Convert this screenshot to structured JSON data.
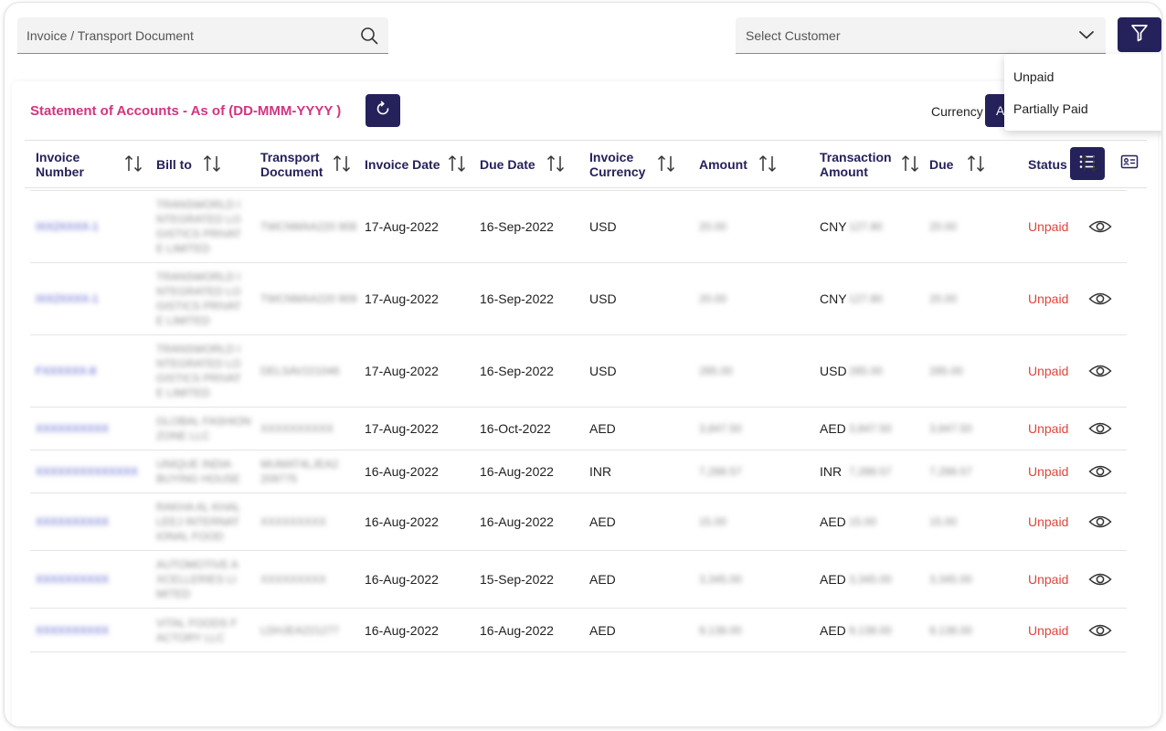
{
  "search": {
    "placeholder": "Invoice / Transport Document"
  },
  "customer_select": {
    "placeholder": "Select Customer"
  },
  "status_filter_options": [
    "Unpaid",
    "Partially Paid"
  ],
  "statement": {
    "title": "Statement of Accounts - As of (DD-MMM-YYYY )",
    "currency_label": "Currency",
    "currency_value": "A"
  },
  "table": {
    "columns": [
      "Invoice Number",
      "Bill to",
      "Transport Document",
      "Invoice Date",
      "Due Date",
      "Invoice Currency",
      "Amount",
      "Transaction Amount",
      "Due",
      "Status"
    ],
    "rows": [
      {
        "invoice": "IXX2XXXX-1",
        "bill_to": "TRANSWORLD I NTEGRATED LO GISTICS PRIVAT E LIMITED",
        "transport": "TWCNMAA220 908",
        "invoice_date": "17-Aug-2022",
        "due_date": "16-Sep-2022",
        "currency": "USD",
        "amount": "20.00",
        "txn_currency": "CNY",
        "txn_amount": "127.80",
        "due": "20.00",
        "status": "Unpaid"
      },
      {
        "invoice": "IXX2XXXX-1",
        "bill_to": "TRANSWORLD I NTEGRATED LO GISTICS PRIVAT E LIMITED",
        "transport": "TWCNMAA220 909",
        "invoice_date": "17-Aug-2022",
        "due_date": "16-Sep-2022",
        "currency": "USD",
        "amount": "20.00",
        "txn_currency": "CNY",
        "txn_amount": "127.80",
        "due": "20.00",
        "status": "Unpaid"
      },
      {
        "invoice": "FXXXXXX-8",
        "bill_to": "TRANSWORLD I NTEGRATED LO GISTICS PRIVAT E LIMITED",
        "transport": "DELSAV221046",
        "invoice_date": "17-Aug-2022",
        "due_date": "16-Sep-2022",
        "currency": "USD",
        "amount": "285.00",
        "txn_currency": "USD",
        "txn_amount": "285.00",
        "due": "285.00",
        "status": "Unpaid"
      },
      {
        "invoice": "XXXXXXXXXX",
        "bill_to": "GLOBAL FASHION ZONE LLC",
        "transport": "XXXXXXXXXX",
        "invoice_date": "17-Aug-2022",
        "due_date": "16-Oct-2022",
        "currency": "AED",
        "amount": "3,847.50",
        "txn_currency": "AED",
        "txn_amount": "3,847.50",
        "due": "3,847.50",
        "status": "Unpaid"
      },
      {
        "invoice": "XXXXXXXXXXXXXX",
        "bill_to": "UNIQUE INDIA BUYING HOUSE",
        "transport": "MUMAT4LJEA2 209775",
        "invoice_date": "16-Aug-2022",
        "due_date": "16-Aug-2022",
        "currency": "INR",
        "amount": "7,288.57",
        "txn_currency": "INR",
        "txn_amount": "7,288.57",
        "due": "7,288.57",
        "status": "Unpaid"
      },
      {
        "invoice": "XXXXXXXXXX",
        "bill_to": "RAKHA AL KHAL LEEJ INTERNAT IONAL FOOD",
        "transport": "XXXXXXXXX",
        "invoice_date": "16-Aug-2022",
        "due_date": "16-Aug-2022",
        "currency": "AED",
        "amount": "15.00",
        "txn_currency": "AED",
        "txn_amount": "15.00",
        "due": "15.00",
        "status": "Unpaid"
      },
      {
        "invoice": "XXXXXXXXXX",
        "bill_to": "AUTOMOTIVE A XCELLERIES LI MITED",
        "transport": "XXXXXXXXX",
        "invoice_date": "16-Aug-2022",
        "due_date": "15-Sep-2022",
        "currency": "AED",
        "amount": "3,345.00",
        "txn_currency": "AED",
        "txn_amount": "3,345.00",
        "due": "3,345.00",
        "status": "Unpaid"
      },
      {
        "invoice": "XXXXXXXXXX",
        "bill_to": "VITAL FOODS F ACTORY LLC",
        "transport": "LDHJEA221277",
        "invoice_date": "16-Aug-2022",
        "due_date": "16-Aug-2022",
        "currency": "AED",
        "amount": "9,138.00",
        "txn_currency": "AED",
        "txn_amount": "9,138.00",
        "due": "9,138.00",
        "status": "Unpaid"
      }
    ]
  }
}
